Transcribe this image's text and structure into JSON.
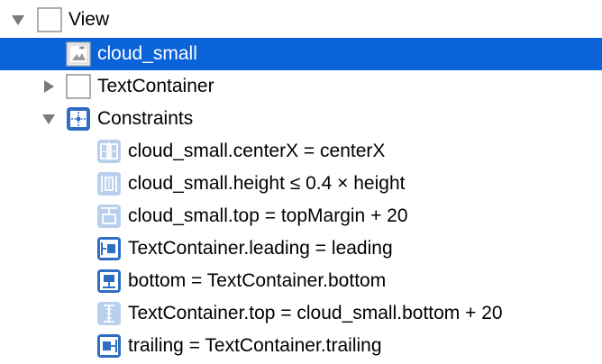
{
  "tree": {
    "view": {
      "label": "View",
      "expanded": true
    },
    "image_item": {
      "label": "cloud_small",
      "selected": true
    },
    "text_container": {
      "label": "TextContainer",
      "expanded": false
    },
    "constraints": {
      "label": "Constraints",
      "expanded": true,
      "items": [
        {
          "label": "cloud_small.centerX = centerX",
          "icon": "align-center-x-constraint-icon",
          "style": "light"
        },
        {
          "label": "cloud_small.height ≤ 0.4 × height",
          "icon": "height-constraint-icon",
          "style": "light"
        },
        {
          "label": "cloud_small.top = topMargin + 20",
          "icon": "top-constraint-icon",
          "style": "light"
        },
        {
          "label": "TextContainer.leading = leading",
          "icon": "leading-constraint-icon",
          "style": "dark"
        },
        {
          "label": "bottom = TextContainer.bottom",
          "icon": "bottom-constraint-icon",
          "style": "dark"
        },
        {
          "label": "TextContainer.top = cloud_small.bottom + 20",
          "icon": "top-constraint-icon",
          "style": "light"
        },
        {
          "label": "trailing = TextContainer.trailing",
          "icon": "trailing-constraint-icon",
          "style": "dark"
        }
      ]
    }
  },
  "colors": {
    "selection": "#0b63d9",
    "constraint_dark": "#2f6dc4",
    "constraint_light": "#b9cfee"
  }
}
